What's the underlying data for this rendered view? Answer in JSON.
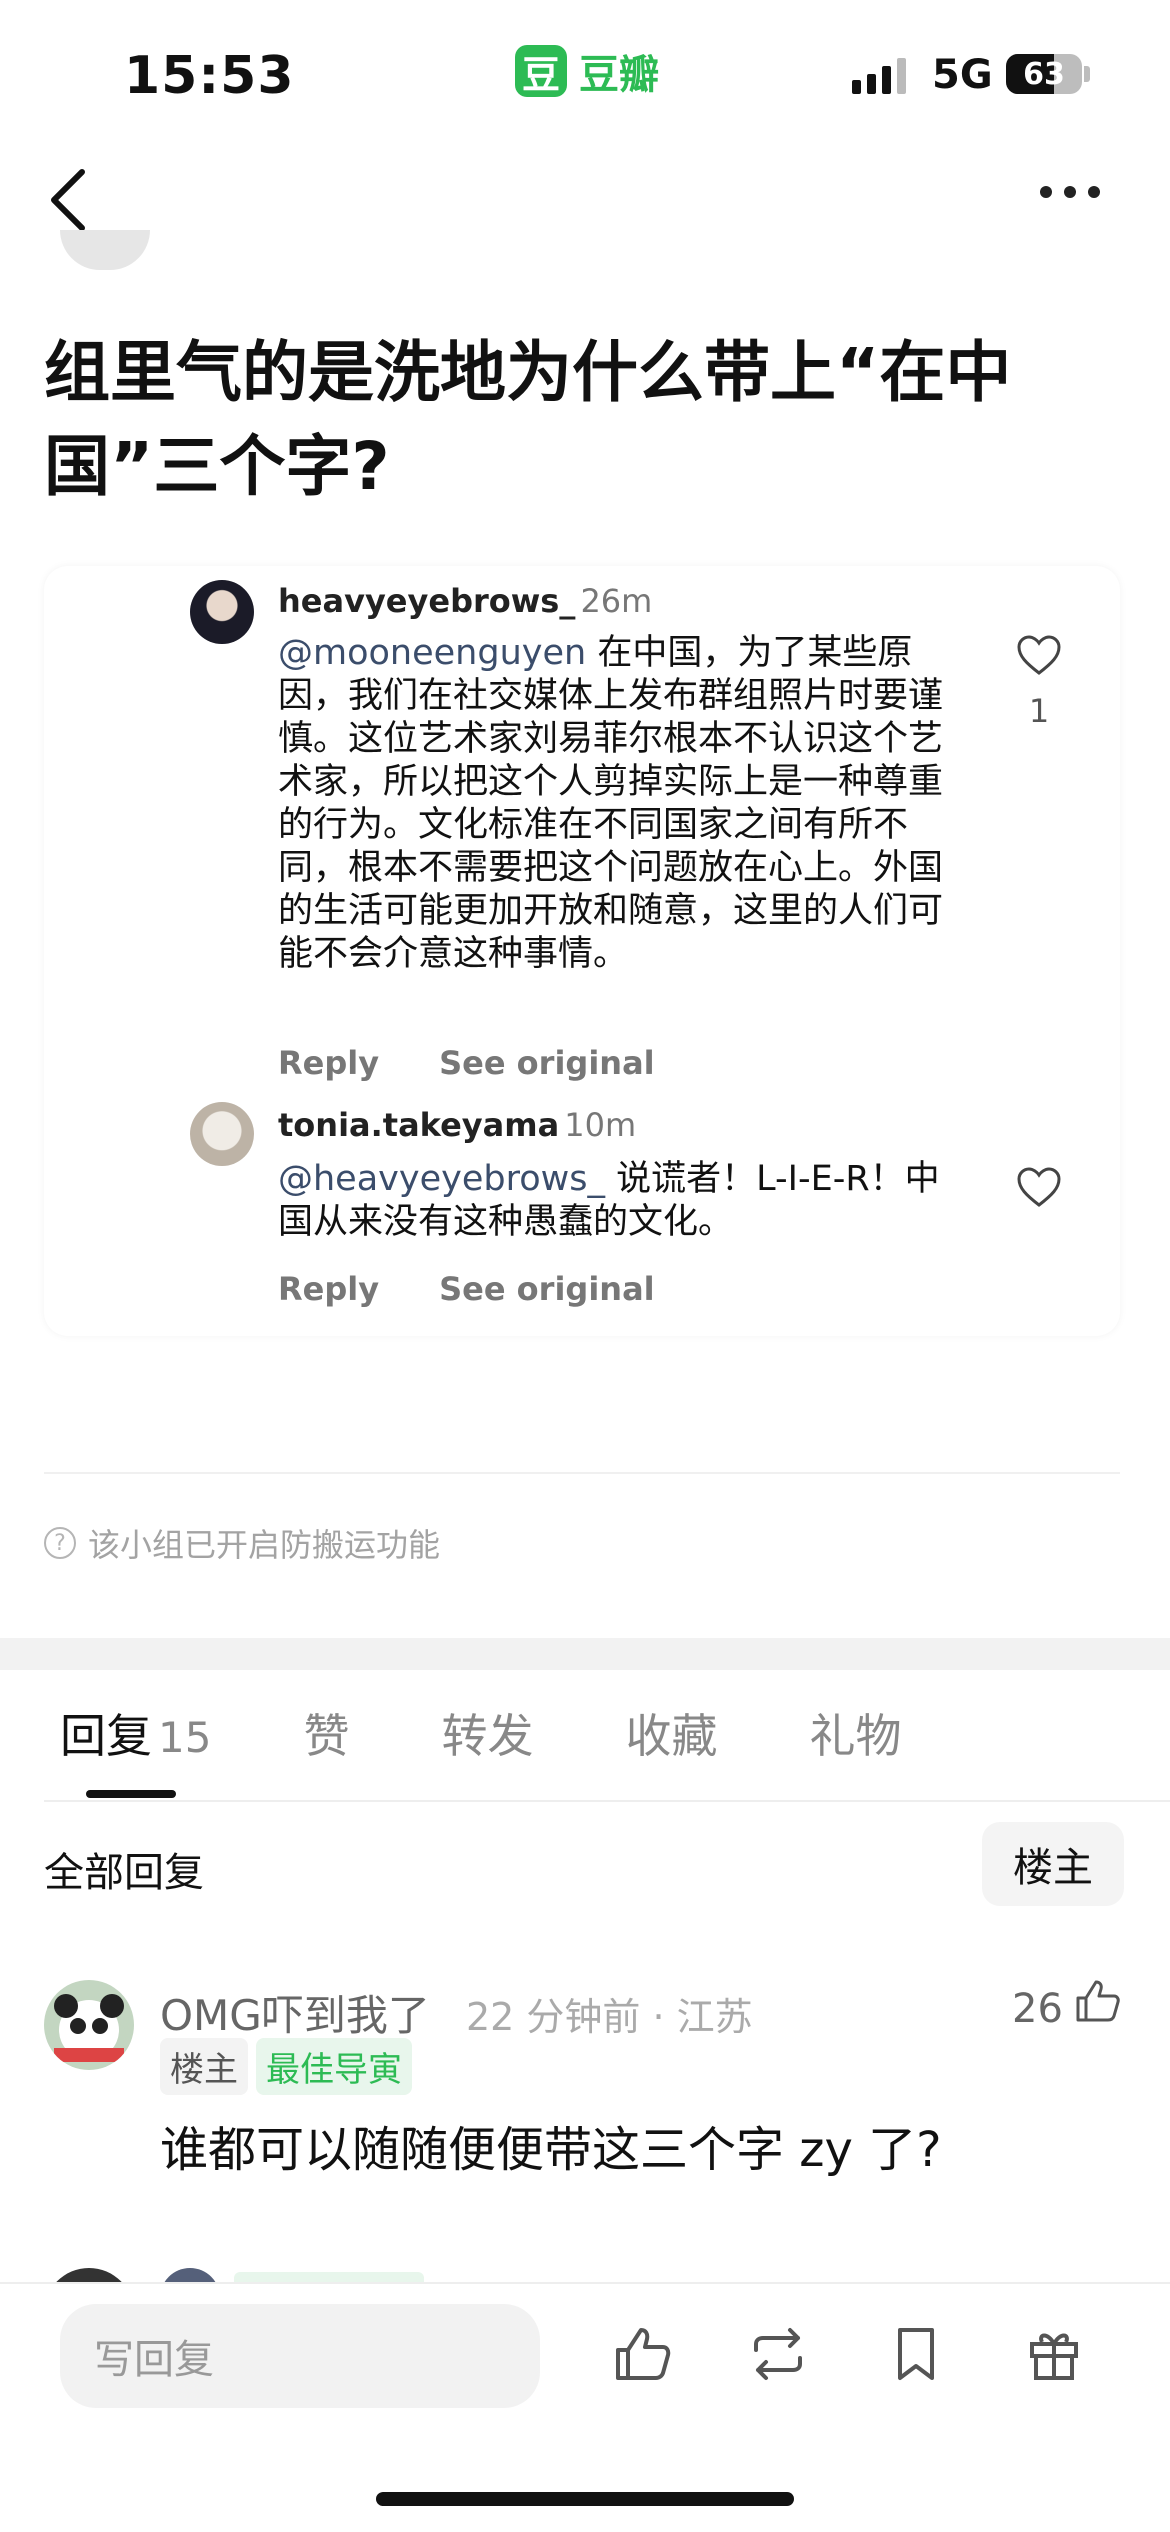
{
  "status": {
    "time": "15:53",
    "app_logo_char": "豆",
    "app_name": "豆瓣",
    "network": "5G",
    "battery": "63",
    "battery_level_pct": 63
  },
  "post": {
    "title": "组里气的是洗地为什么带上“在中国”三个字?"
  },
  "screenshot": {
    "comments": [
      {
        "user": "heavyeyebrows_",
        "time": "26m",
        "mention": "@mooneenguyen",
        "text": " 在中国，为了某些原因，我们在社交媒体上发布群组照片时要谨慎。这位艺术家刘易菲尔根本不认识这个艺术家，所以把这个人剪掉实际上是一种尊重的行为。文化标准在不同国家之间有所不同，根本不需要把这个问题放在心上。外国的生活可能更加开放和随意，这里的人们可能不会介意这种事情。",
        "likes": "1",
        "reply": "Reply",
        "see_original": "See original"
      },
      {
        "user": "tonia.takeyama",
        "time": "10m",
        "mention": "@heavyeyebrows_",
        "text": " 说谎者！L-I-E-R！中国从来没有这种愚蠢的文化。",
        "likes": "",
        "reply": "Reply",
        "see_original": "See original"
      }
    ]
  },
  "notice": "该小组已开启防搬运功能",
  "tabs": [
    {
      "label": "回复",
      "count": "15"
    },
    {
      "label": "赞",
      "count": ""
    },
    {
      "label": "转发",
      "count": ""
    },
    {
      "label": "收藏",
      "count": ""
    },
    {
      "label": "礼物",
      "count": ""
    }
  ],
  "replies_header": {
    "title": "全部回复",
    "op_filter": "楼主"
  },
  "reply": {
    "name": "OMG吓到我了",
    "meta": "22 分钟前 · 江苏",
    "likes": "26",
    "tag_op": "楼主",
    "tag_best": "最佳导寅",
    "text": "谁都可以随随便便带这三个字 zy 了?"
  },
  "bottom_bar": {
    "reply_placeholder": "写回复"
  },
  "colors": {
    "brand_green": "#2dbb54",
    "tag_green_bg": "#e8f6ec"
  }
}
